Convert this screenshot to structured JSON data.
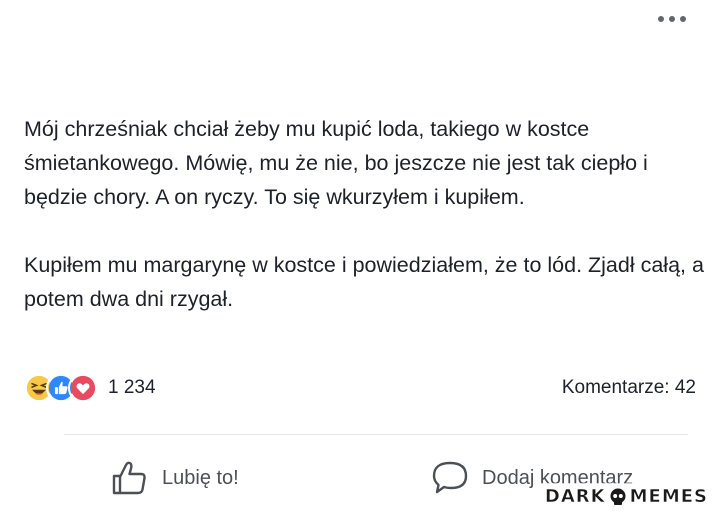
{
  "post": {
    "paragraphs": [
      "Mój chrześniak chciał żeby mu kupić loda, takiego w kostce śmietankowego. Mówię, mu że nie, bo jeszcze nie jest tak ciepło i będzie chory. A on ryczy. To się wkurzyłem i kupiłem.",
      "Kupiłem mu margarynę w kostce i powiedziałem, że to lód. Zjadł całą, a potem dwa dni rzygał."
    ]
  },
  "reactions": {
    "icons": [
      "haha-icon",
      "like-reaction-icon",
      "love-icon"
    ],
    "count": "1 234"
  },
  "comments": {
    "label": "Komentarze: 42"
  },
  "actions": {
    "like_label": "Lubię to!",
    "comment_label": "Dodaj komentarz"
  },
  "watermark": {
    "left": "DARK",
    "right": "MEMES"
  },
  "colors": {
    "like_blue": "#2d88ff",
    "love_red": "#e84a5f",
    "haha_yellow": "#f7c948",
    "text": "#1d2129",
    "muted": "#4b4f56"
  }
}
